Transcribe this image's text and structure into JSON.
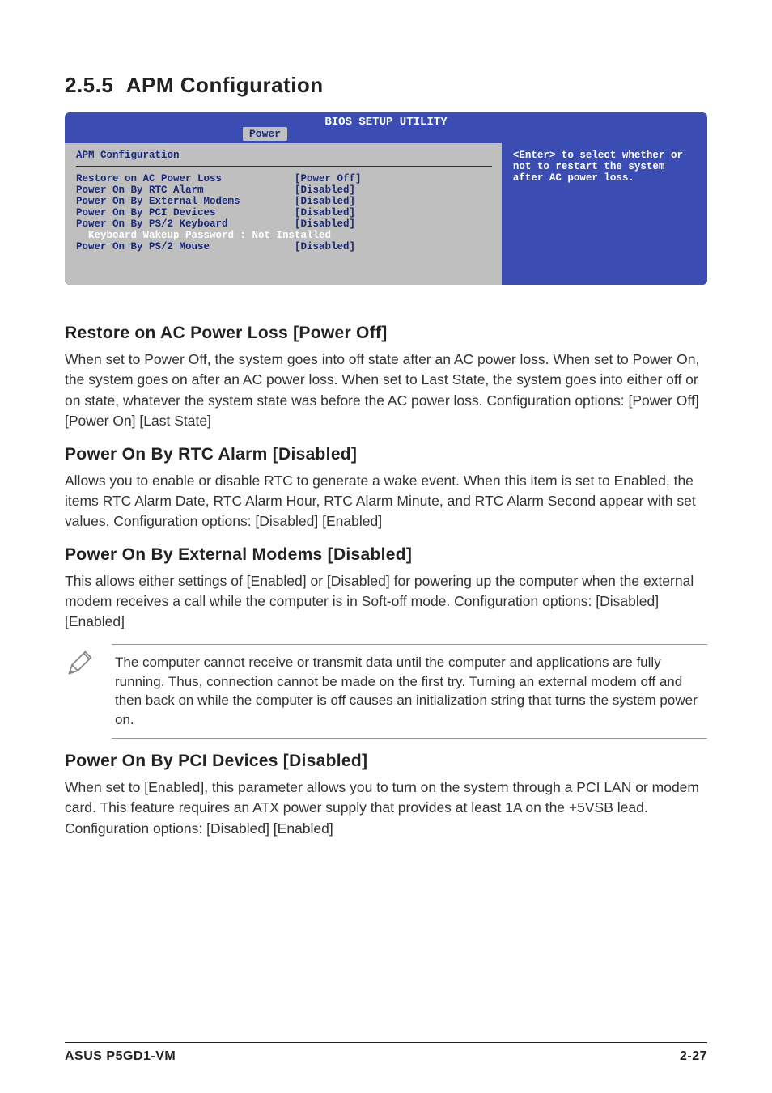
{
  "section_number": "2.5.5",
  "section_title": "APM Configuration",
  "bios": {
    "title": "BIOS SETUP UTILITY",
    "tab": "Power",
    "config_title": "APM Configuration",
    "rows": [
      {
        "label": "Restore on AC Power Loss",
        "value": "[Power Off]"
      },
      {
        "label": "Power On By RTC Alarm",
        "value": "[Disabled]"
      },
      {
        "label": "Power On By External Modems",
        "value": "[Disabled]"
      },
      {
        "label": "Power On By PCI Devices",
        "value": "[Disabled]"
      },
      {
        "label": "Power On By PS/2 Keyboard",
        "value": "[Disabled]"
      }
    ],
    "highlight_row": "  Keyboard Wakeup Password : Not Installed",
    "last_row": {
      "label": "Power On By PS/2 Mouse",
      "value": "[Disabled]"
    },
    "help": "<Enter> to select whether or not to restart the system after AC power loss."
  },
  "subs": [
    {
      "title": "Restore on AC Power Loss [Power Off]",
      "text": "When set to Power Off, the system goes into off state after an AC power loss. When set to Power On, the system goes on after an AC power loss. When set to Last State, the system goes into either off or on state, whatever the system state was before the AC power loss. Configuration options: [Power Off] [Power On] [Last State]"
    },
    {
      "title": "Power On By RTC Alarm [Disabled]",
      "text": "Allows you to enable or disable RTC to generate a wake event. When this item is set to Enabled, the items RTC Alarm Date, RTC Alarm Hour, RTC Alarm Minute, and RTC Alarm Second appear with set values. Configuration options: [Disabled] [Enabled]"
    },
    {
      "title": "Power On By External Modems [Disabled]",
      "text": "This allows either settings of [Enabled] or [Disabled] for powering up the computer when the external modem receives a call while the computer is in Soft-off mode. Configuration options: [Disabled] [Enabled]"
    }
  ],
  "note": "The computer cannot receive or transmit data until the computer and applications are fully running. Thus, connection cannot be made on the first try. Turning an external modem off and then back on while the computer is off causes an initialization string that turns the system power on.",
  "sub_last": {
    "title": "Power On By PCI Devices [Disabled]",
    "text": "When set to [Enabled], this parameter allows you to turn on the system through a PCI LAN or modem card. This feature requires an ATX power supply that provides at least 1A on the +5VSB lead. Configuration options: [Disabled] [Enabled]"
  },
  "footer": {
    "left": "ASUS P5GD1-VM",
    "right": "2-27"
  }
}
